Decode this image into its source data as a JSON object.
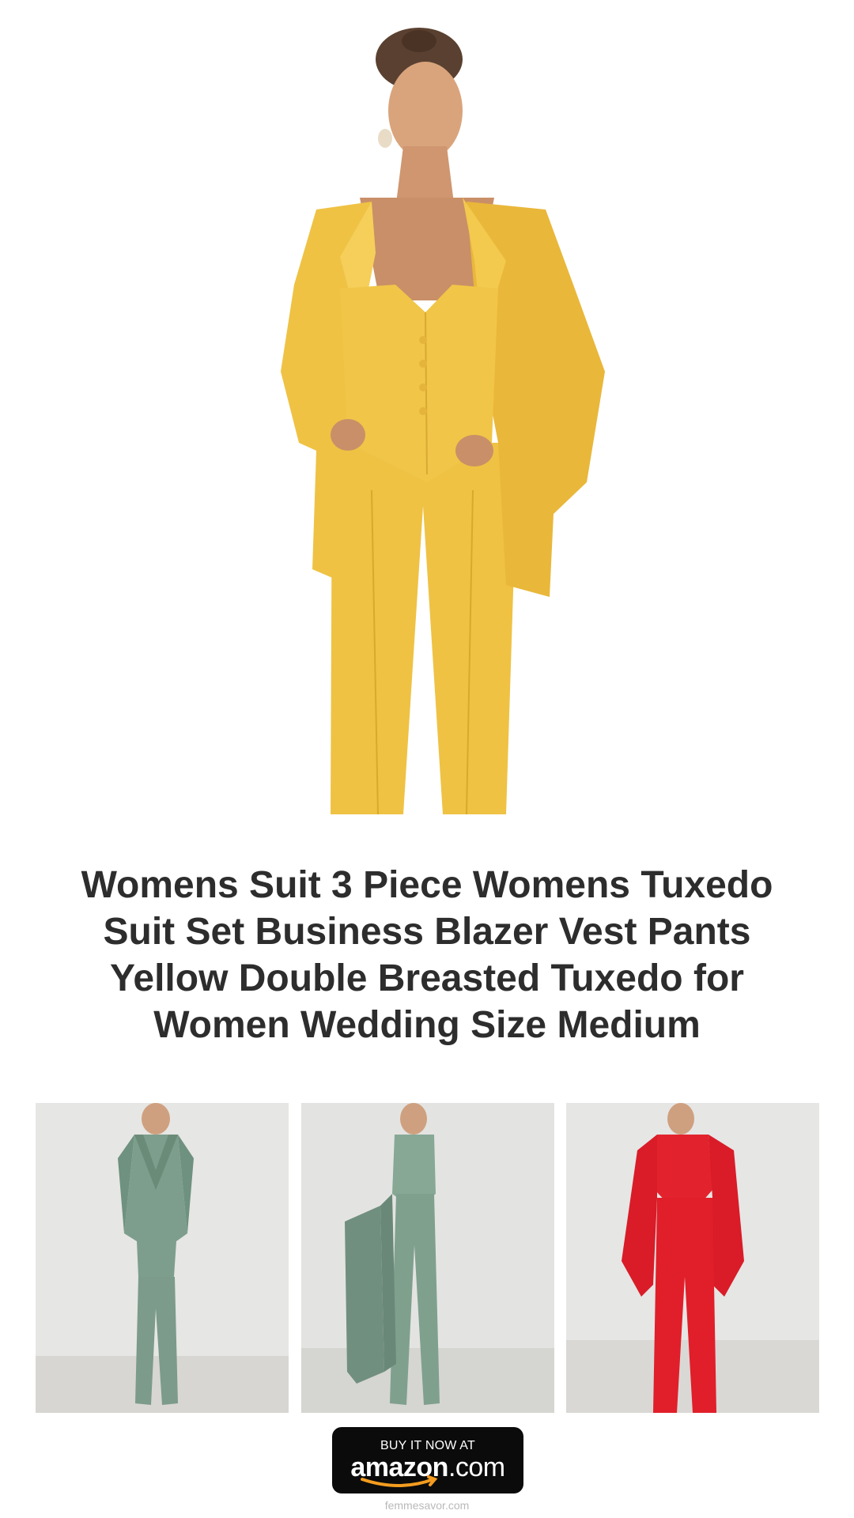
{
  "product": {
    "title": "Womens Suit 3 Piece Womens Tuxedo Suit Set Business Blazer Vest Pants Yellow Double Breasted Tuxedo for Women Wedding Size Medium",
    "hero_color": "#EFC244",
    "hero_icon": "yellow-suit-model-photo"
  },
  "thumbnails": [
    {
      "color": "#7D9E8C",
      "icon": "sage-green-double-breasted-suit-photo"
    },
    {
      "color": "#86A895",
      "icon": "sage-green-vest-pants-photo"
    },
    {
      "color": "#E2232E",
      "icon": "red-suit-vest-photo"
    }
  ],
  "cta": {
    "top_text": "BUY IT NOW AT",
    "brand_bold": "amazon",
    "brand_regular": ".com",
    "background": "#0B0B0B",
    "smile_color": "#F39C1F"
  },
  "footer": {
    "domain": "femmesavor.com"
  }
}
